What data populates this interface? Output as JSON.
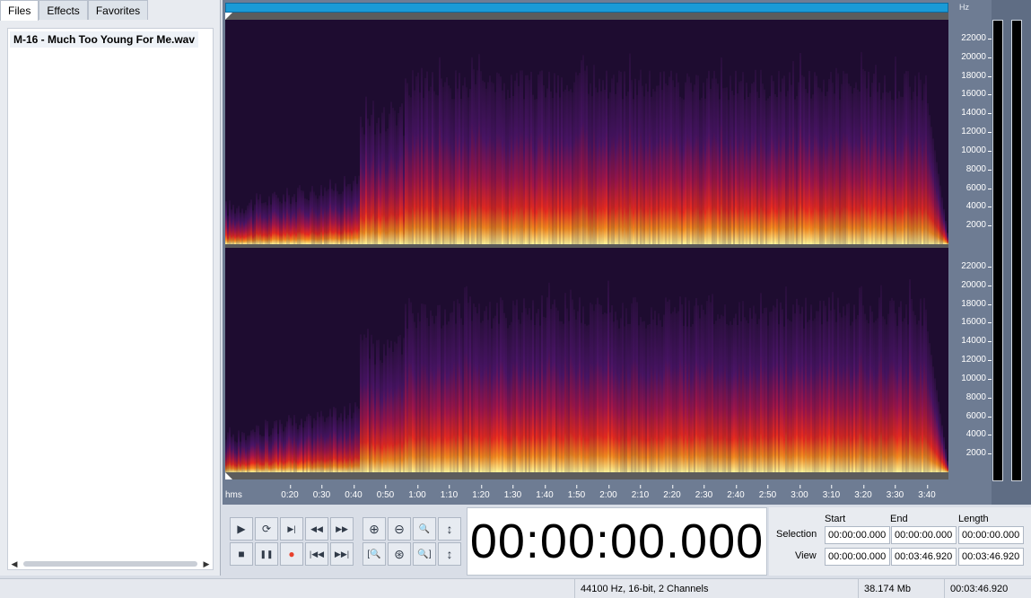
{
  "left_panel": {
    "tabs": [
      {
        "label": "Files"
      },
      {
        "label": "Effects"
      },
      {
        "label": "Favorites"
      }
    ],
    "files": [
      "M-16 - Much Too Young For Me.wav"
    ]
  },
  "editor": {
    "freq_unit": "Hz",
    "freq_ticks": [
      "22000",
      "20000",
      "18000",
      "16000",
      "14000",
      "12000",
      "10000",
      "8000",
      "6000",
      "4000",
      "2000"
    ],
    "time_unit": "hms",
    "time_ticks": [
      "0:20",
      "0:30",
      "0:40",
      "0:50",
      "1:00",
      "1:10",
      "1:20",
      "1:30",
      "1:40",
      "1:50",
      "2:00",
      "2:10",
      "2:20",
      "2:30",
      "2:40",
      "2:50",
      "3:00",
      "3:10",
      "3:20",
      "3:30",
      "3:40"
    ]
  },
  "transport": {
    "buttons": [
      {
        "name": "play-button",
        "glyph": "▶"
      },
      {
        "name": "loop-button",
        "glyph": "⟳"
      },
      {
        "name": "play-to-end-button",
        "glyph": "▶|"
      },
      {
        "name": "rewind-button",
        "glyph": "◀◀"
      },
      {
        "name": "fast-forward-button",
        "glyph": "▶▶"
      },
      {
        "name": "stop-button",
        "glyph": "■"
      },
      {
        "name": "pause-button",
        "glyph": "❚❚"
      },
      {
        "name": "record-button",
        "glyph": "●"
      },
      {
        "name": "go-to-start-button",
        "glyph": "|◀◀"
      },
      {
        "name": "go-to-end-button",
        "glyph": "▶▶|"
      }
    ],
    "record_color": "#e8402c"
  },
  "zoom": {
    "buttons": [
      {
        "name": "zoom-in-icon",
        "glyph": "⊕"
      },
      {
        "name": "zoom-out-icon",
        "glyph": "⊖"
      },
      {
        "name": "zoom-100-icon",
        "glyph": "🔍"
      },
      {
        "name": "zoom-vertical-icon",
        "glyph": "↕"
      },
      {
        "name": "zoom-selection-left-icon",
        "glyph": "[🔍"
      },
      {
        "name": "zoom-selection-icon",
        "glyph": "⊛"
      },
      {
        "name": "zoom-selection-right-icon",
        "glyph": "🔍]"
      },
      {
        "name": "zoom-vertical-fit-icon",
        "glyph": "↕"
      }
    ]
  },
  "time_display": "00:00:00.000",
  "selection_view": {
    "headers": {
      "start": "Start",
      "end": "End",
      "length": "Length"
    },
    "selection_label": "Selection",
    "view_label": "View",
    "selection": {
      "start": "00:00:00.000",
      "end": "00:00:00.000",
      "length": "00:00:00.000"
    },
    "view": {
      "start": "00:00:00.000",
      "end": "00:03:46.920",
      "length": "00:03:46.920"
    }
  },
  "status": {
    "format": "44100 Hz, 16-bit, 2 Channels",
    "size": "38.174 Mb",
    "duration": "00:03:46.920"
  },
  "colors": {
    "overview_bar": "#1a9ad6",
    "editor_bg": "#6e7c93"
  }
}
